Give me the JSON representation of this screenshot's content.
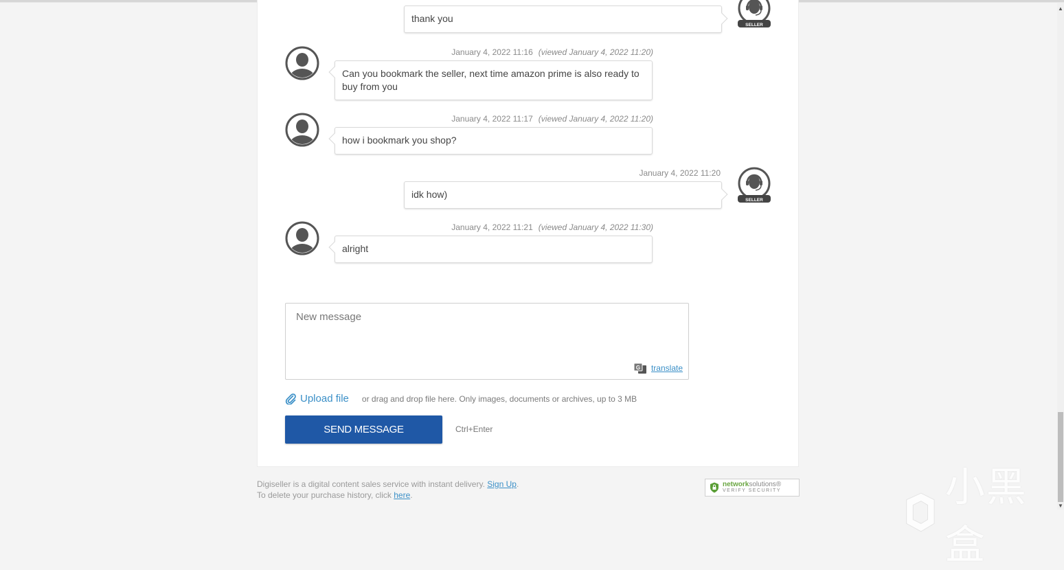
{
  "messages": [
    {
      "sender": "seller",
      "text": "thank you",
      "timestamp": "",
      "viewed": ""
    },
    {
      "sender": "buyer",
      "text": "Can you bookmark the seller, next time amazon prime is also ready to buy from you",
      "timestamp": "January 4, 2022 11:16",
      "viewed": "(viewed January 4, 2022 11:20)"
    },
    {
      "sender": "buyer",
      "text": "how i bookmark you shop?",
      "timestamp": "January 4, 2022 11:17",
      "viewed": "(viewed January 4, 2022 11:20)"
    },
    {
      "sender": "seller",
      "text": "idk how)",
      "timestamp": "January 4, 2022 11:20",
      "viewed": ""
    },
    {
      "sender": "buyer",
      "text": "alright",
      "timestamp": "January 4, 2022 11:21",
      "viewed": "(viewed January 4, 2022 11:30)"
    }
  ],
  "seller_badge": "SELLER",
  "compose": {
    "placeholder": "New message",
    "value": "",
    "translate_label": "translate"
  },
  "upload": {
    "link_label": "Upload file",
    "hint": "or drag and drop file here. Only images, documents or archives, up to 3 MB"
  },
  "send_button_label": "SEND MESSAGE",
  "send_shortcut": "Ctrl+Enter",
  "footer": {
    "line1_text": "Digiseller is a digital content sales service with instant delivery.",
    "line1_link": "Sign Up",
    "line2_text": "To delete your purchase history, click",
    "line2_link": "here",
    "period": "."
  },
  "security_badge": {
    "brand_bold": "network",
    "brand_light": "solutions",
    "reg": "®",
    "subtitle": "VERIFY SECURITY"
  },
  "watermark": "小黑盒",
  "colors": {
    "accent_blue": "#1f58a6",
    "link_blue": "#3a8fc7",
    "background": "#f4f4f4"
  }
}
